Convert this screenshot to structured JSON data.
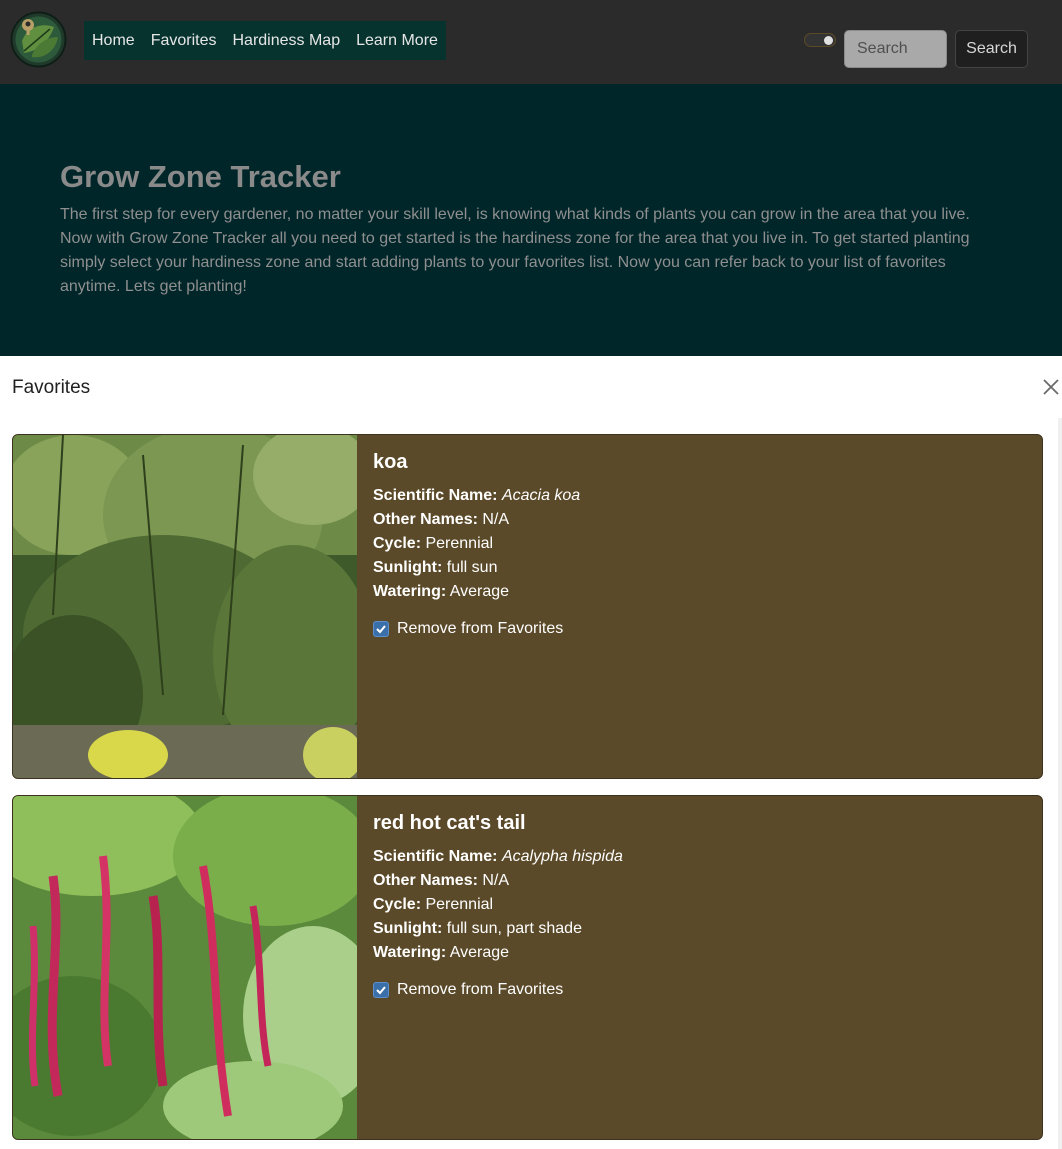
{
  "header": {
    "logo": "globe-leaf-logo",
    "nav_links": [
      "Home",
      "Favorites",
      "Hardiness Map",
      "Learn More"
    ],
    "search": {
      "placeholder": "Search",
      "button_label": "Search"
    }
  },
  "hero": {
    "title": "Grow Zone Tracker",
    "description": "The first step for every gardener, no matter your skill level, is knowing what kinds of plants you can grow in the area that you live. Now with Grow Zone Tracker all you need to get started is the hardiness zone for the area that you live in. To get started planting simply select your hardiness zone and start adding plants to your favorites list. Now you can refer back to your list of favorites anytime. Lets get planting!"
  },
  "favorites": {
    "title": "Favorites",
    "labels": {
      "scientific": "Scientific Name:",
      "other": "Other Names:",
      "cycle": "Cycle:",
      "sunlight": "Sunlight:",
      "watering": "Watering:"
    },
    "plants": [
      {
        "name": "koa",
        "scientific_name": "Acacia koa",
        "other_names": "N/A",
        "cycle": "Perennial",
        "sunlight": "full sun",
        "watering": "Average",
        "favorite_label": "Remove from Favorites",
        "checked": true
      },
      {
        "name": "red hot cat's tail",
        "scientific_name": "Acalypha hispida",
        "other_names": "N/A",
        "cycle": "Perennial",
        "sunlight": "full sun, part shade",
        "watering": "Average",
        "favorite_label": "Remove from Favorites",
        "checked": true
      }
    ]
  },
  "colors": {
    "navbar": "#2b2b2b",
    "nav_links_bg": "#07332f",
    "hero_bg": "#00262a",
    "card_bg": "#5b4a29",
    "checkbox": "#3b6faa"
  }
}
